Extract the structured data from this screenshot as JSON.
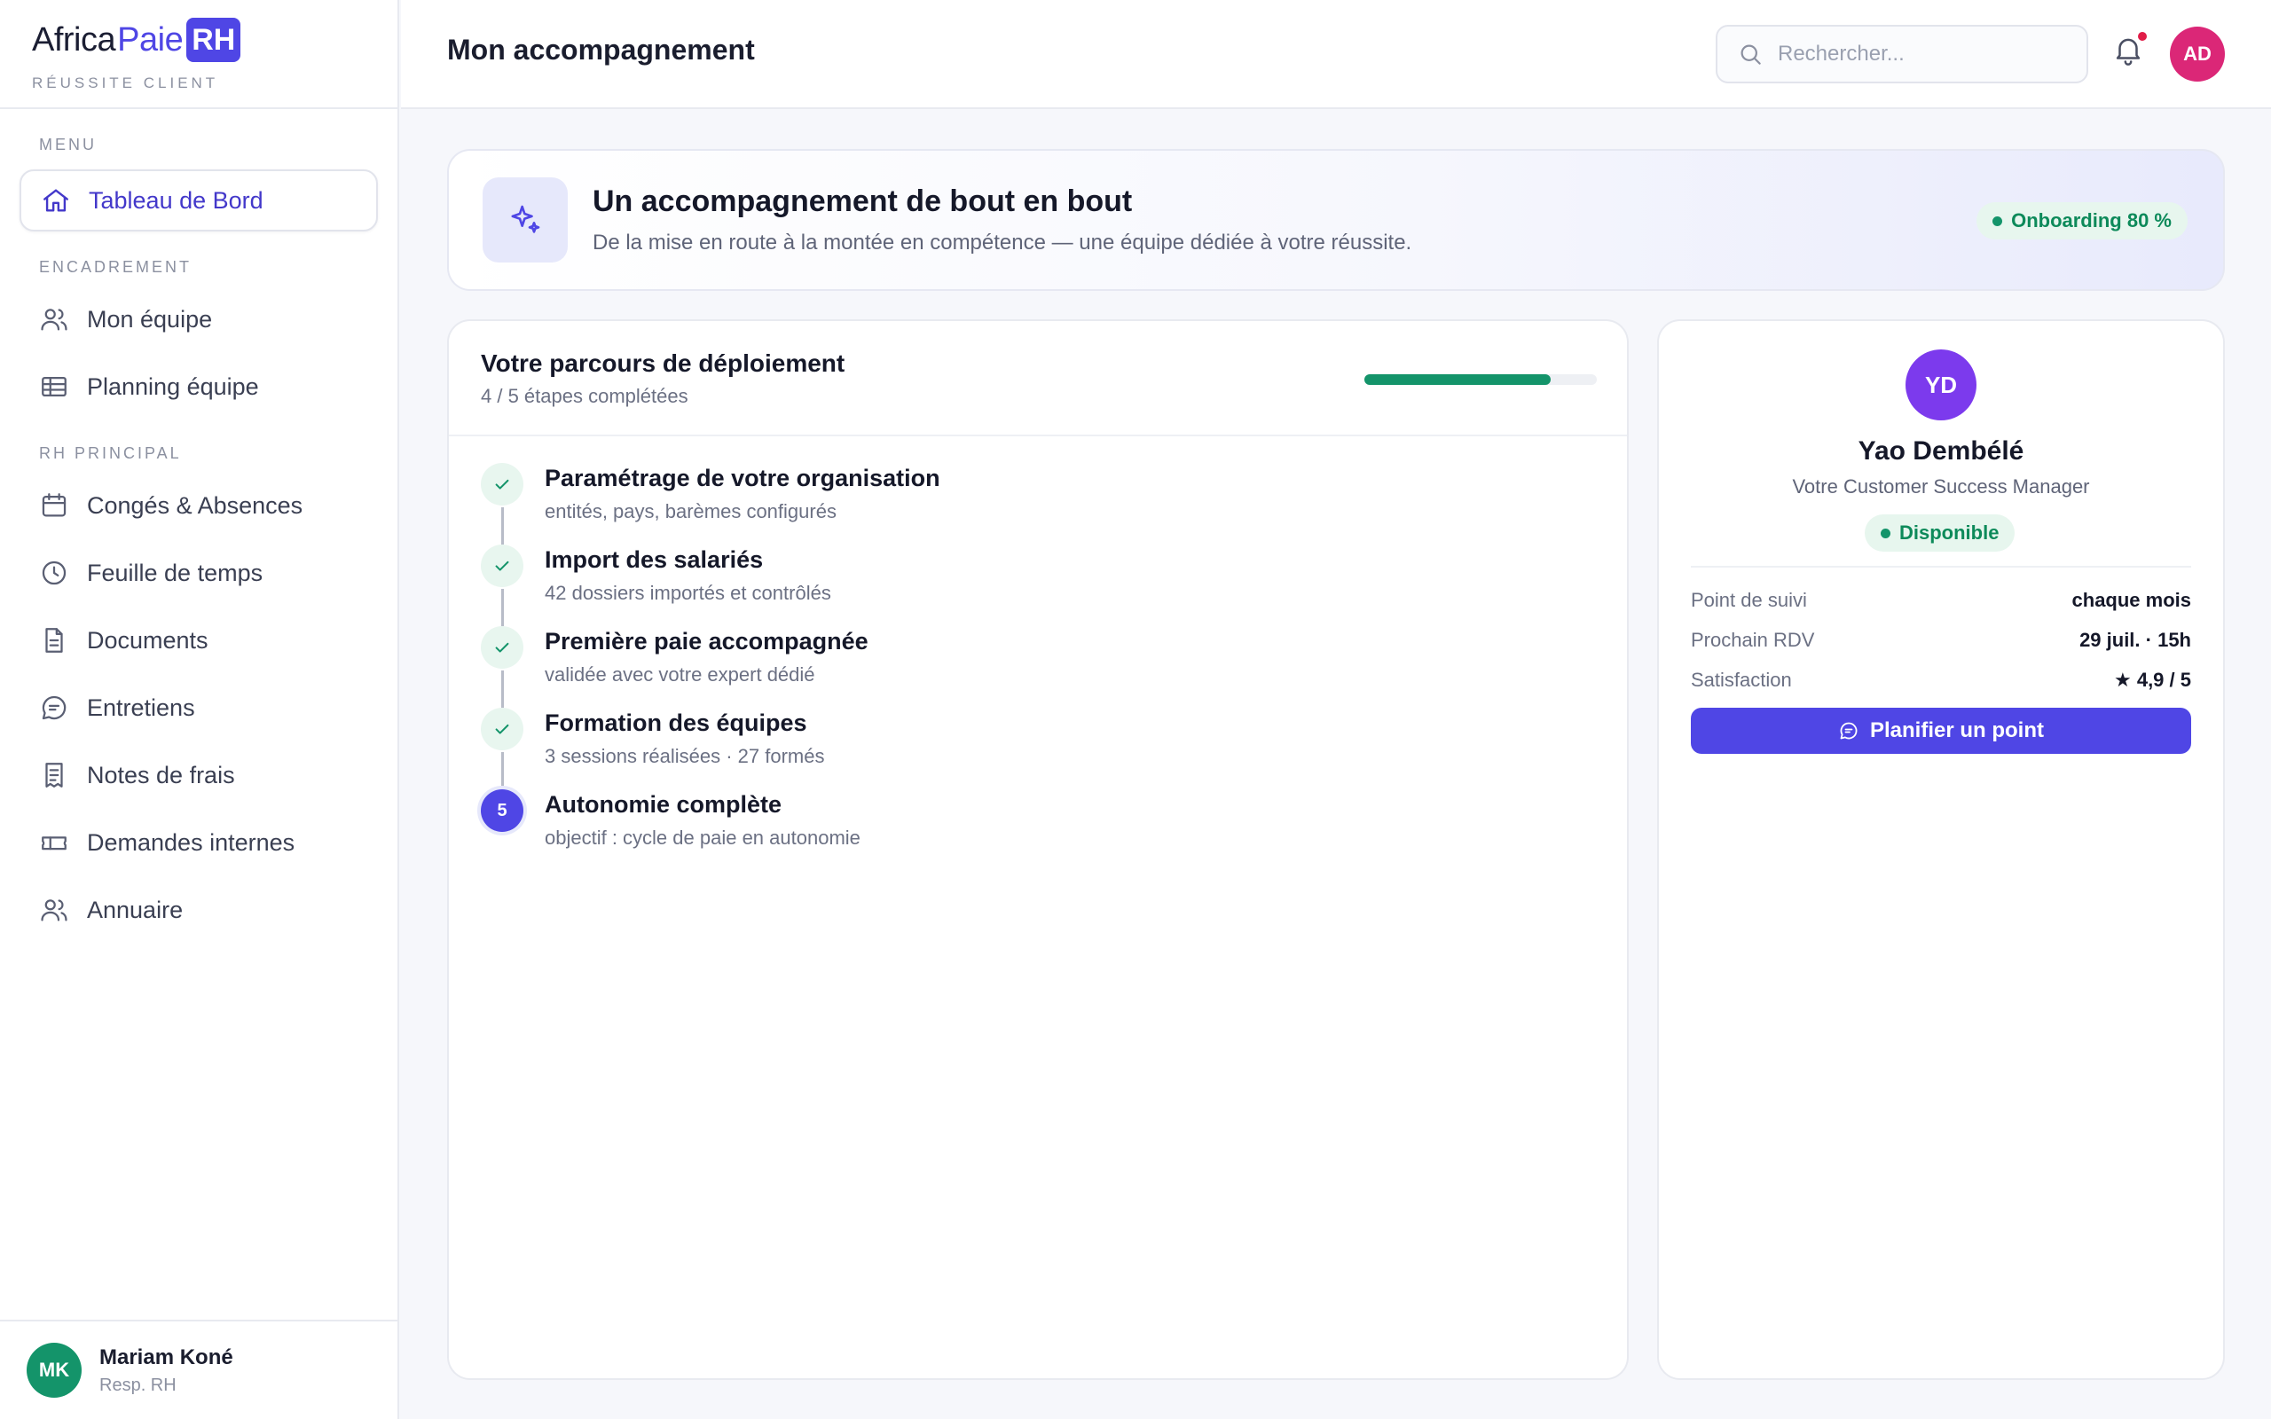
{
  "brand": {
    "name_part1": "Africa",
    "name_part2": "Paie",
    "badge": "RH",
    "subtitle": "RÉUSSITE CLIENT"
  },
  "sidebar": {
    "sections": [
      {
        "title": "MENU",
        "items": [
          {
            "label": "Tableau de Bord",
            "icon": "home-icon",
            "active": true
          }
        ]
      },
      {
        "title": "ENCADREMENT",
        "items": [
          {
            "label": "Mon équipe",
            "icon": "users-icon"
          },
          {
            "label": "Planning équipe",
            "icon": "table-icon"
          }
        ]
      },
      {
        "title": "RH PRINCIPAL",
        "items": [
          {
            "label": "Congés & Absences",
            "icon": "calendar-icon"
          },
          {
            "label": "Feuille de temps",
            "icon": "clock-icon"
          },
          {
            "label": "Documents",
            "icon": "document-icon"
          },
          {
            "label": "Entretiens",
            "icon": "chat-icon"
          },
          {
            "label": "Notes de frais",
            "icon": "receipt-icon"
          },
          {
            "label": "Demandes internes",
            "icon": "ticket-icon"
          },
          {
            "label": "Annuaire",
            "icon": "contacts-icon"
          }
        ]
      }
    ],
    "user": {
      "initials": "MK",
      "name": "Mariam Koné",
      "role": "Resp. RH",
      "avatar_color": "#14946a"
    }
  },
  "header": {
    "title": "Mon accompagnement",
    "search_placeholder": "Rechercher...",
    "user_initials": "AD",
    "avatar_color": "#db2777",
    "has_notification": true
  },
  "banner": {
    "title": "Un accompagnement de bout en bout",
    "subtitle": "De la mise en route à la montée en compétence — une équipe dédiée à votre réussite.",
    "badge": "Onboarding 80 %"
  },
  "journey": {
    "title": "Votre parcours de déploiement",
    "subtitle": "4 / 5 étapes complétées",
    "progress": 0.8,
    "steps": [
      {
        "title": "Paramétrage de votre organisation",
        "desc": "entités, pays, barèmes configurés",
        "status": "done"
      },
      {
        "title": "Import des salariés",
        "desc": "42 dossiers importés et contrôlés",
        "status": "done"
      },
      {
        "title": "Première paie accompagnée",
        "desc": "validée avec votre expert dédié",
        "status": "done"
      },
      {
        "title": "Formation des équipes",
        "desc": "3 sessions réalisées · 27 formés",
        "status": "done"
      },
      {
        "title": "Autonomie complète",
        "desc": "objectif : cycle de paie en autonomie",
        "status": "current",
        "number": "5"
      }
    ]
  },
  "csm": {
    "initials": "YD",
    "name": "Yao Dembélé",
    "role": "Votre Customer Success Manager",
    "status": "Disponible",
    "avatar_color": "#7c3aed",
    "rows": [
      {
        "label": "Point de suivi",
        "value": "chaque mois"
      },
      {
        "label": "Prochain RDV",
        "value": "29 juil. · 15h"
      },
      {
        "label": "Satisfaction",
        "value": "★ 4,9 / 5"
      }
    ],
    "cta": "Planifier un point"
  },
  "colors": {
    "accent": "#4f46e5",
    "success": "#14946a"
  }
}
